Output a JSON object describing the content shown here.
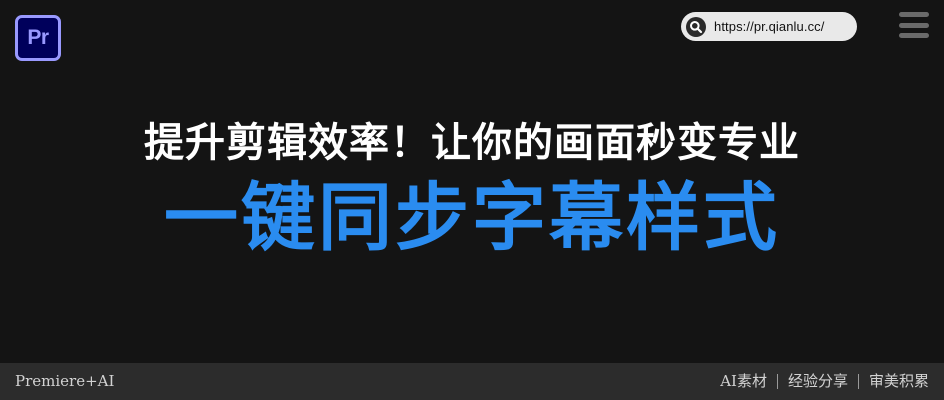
{
  "header": {
    "app_badge_label": "Pr",
    "url_text": "https://pr.qianlu.cc/",
    "search_icon": "search-icon",
    "menu_icon": "menu-icon"
  },
  "hero": {
    "subtitle": "提升剪辑效率！让你的画面秒变专业",
    "title": "一键同步字幕样式"
  },
  "footer": {
    "left_label": "Premiere+AI",
    "tags": [
      "AI素材",
      "经验分享",
      "审美积累"
    ]
  },
  "colors": {
    "background": "#141414",
    "title_blue": "#2a8cf0",
    "footer_bar": "#2c2c2c",
    "badge_bg": "#00005b",
    "badge_fg": "#9999ff"
  }
}
